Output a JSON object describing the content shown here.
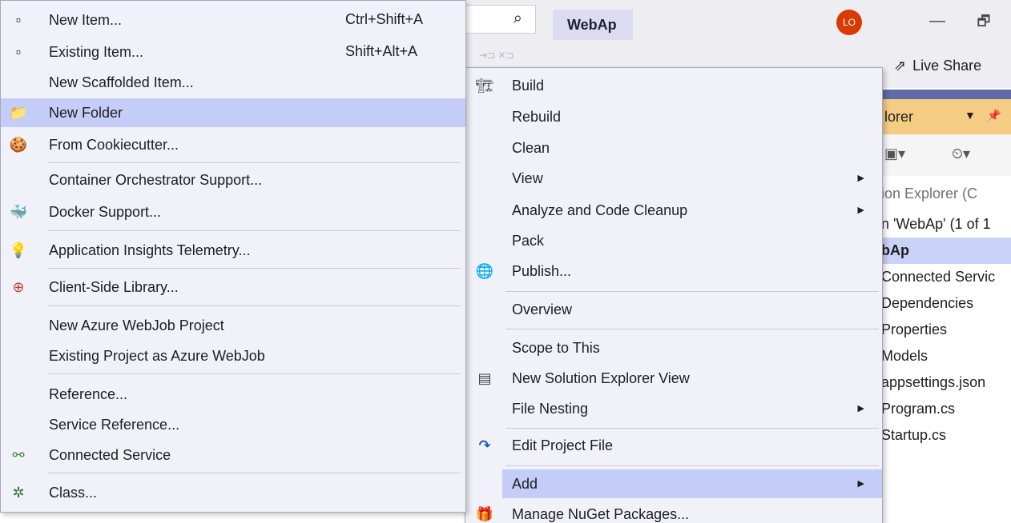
{
  "titlebar": {
    "project": "WebAp",
    "avatar_initials": "LO",
    "minimize": "—",
    "restore": "🗗"
  },
  "toolbar": {
    "live_share": "Live Share"
  },
  "solution_explorer": {
    "header": "lorer",
    "search_placeholder": "ion Explorer (C",
    "tree": [
      {
        "label": "n 'WebAp' (1 of 1"
      },
      {
        "label": "bAp"
      },
      {
        "label": "Connected Servic"
      },
      {
        "label": "Dependencies"
      },
      {
        "label": "Properties"
      },
      {
        "label": "Models"
      },
      {
        "label": "appsettings.json"
      },
      {
        "label": "Program.cs"
      },
      {
        "label": "Startup.cs"
      }
    ]
  },
  "add_submenu": {
    "items": [
      {
        "label": "New Item...",
        "shortcut": "Ctrl+Shift+A",
        "icon": "new-item-icon"
      },
      {
        "label": "Existing Item...",
        "shortcut": "Shift+Alt+A",
        "icon": "existing-item-icon"
      },
      {
        "label": "New Scaffolded Item..."
      },
      {
        "label": "New Folder",
        "icon": "new-folder-icon",
        "highlighted": true
      },
      {
        "label": "From Cookiecutter...",
        "icon": "cookiecutter-icon"
      },
      {
        "label": "Container Orchestrator Support..."
      },
      {
        "label": "Docker Support...",
        "icon": "docker-icon"
      },
      {
        "label": "Application Insights Telemetry...",
        "icon": "app-insights-icon"
      },
      {
        "label": "Client-Side Library...",
        "icon": "client-library-icon"
      },
      {
        "label": "New Azure WebJob Project"
      },
      {
        "label": "Existing Project as Azure WebJob"
      },
      {
        "label": "Reference..."
      },
      {
        "label": "Service Reference..."
      },
      {
        "label": "Connected Service",
        "icon": "connected-service-icon"
      },
      {
        "label": "Class...",
        "icon": "class-icon"
      }
    ]
  },
  "context_menu": {
    "items": [
      {
        "label": "Build",
        "icon": "build-icon"
      },
      {
        "label": "Rebuild"
      },
      {
        "label": "Clean"
      },
      {
        "label": "View",
        "submenu": true
      },
      {
        "label": "Analyze and Code Cleanup",
        "submenu": true
      },
      {
        "label": "Pack"
      },
      {
        "label": "Publish...",
        "icon": "publish-icon"
      },
      {
        "label": "Overview"
      },
      {
        "label": "Scope to This"
      },
      {
        "label": "New Solution Explorer View",
        "icon": "new-view-icon"
      },
      {
        "label": "File Nesting",
        "submenu": true
      },
      {
        "label": "Edit Project File",
        "icon": "edit-project-icon"
      },
      {
        "label": "Add",
        "submenu": true,
        "highlighted": true
      },
      {
        "label": "Manage NuGet Packages...",
        "icon": "nuget-icon"
      }
    ]
  },
  "colors": {
    "menu_bg": "#f1f1fa",
    "highlight": "#c3cdf8",
    "se_header": "#f5cc84",
    "avatar": "#d83b01"
  }
}
